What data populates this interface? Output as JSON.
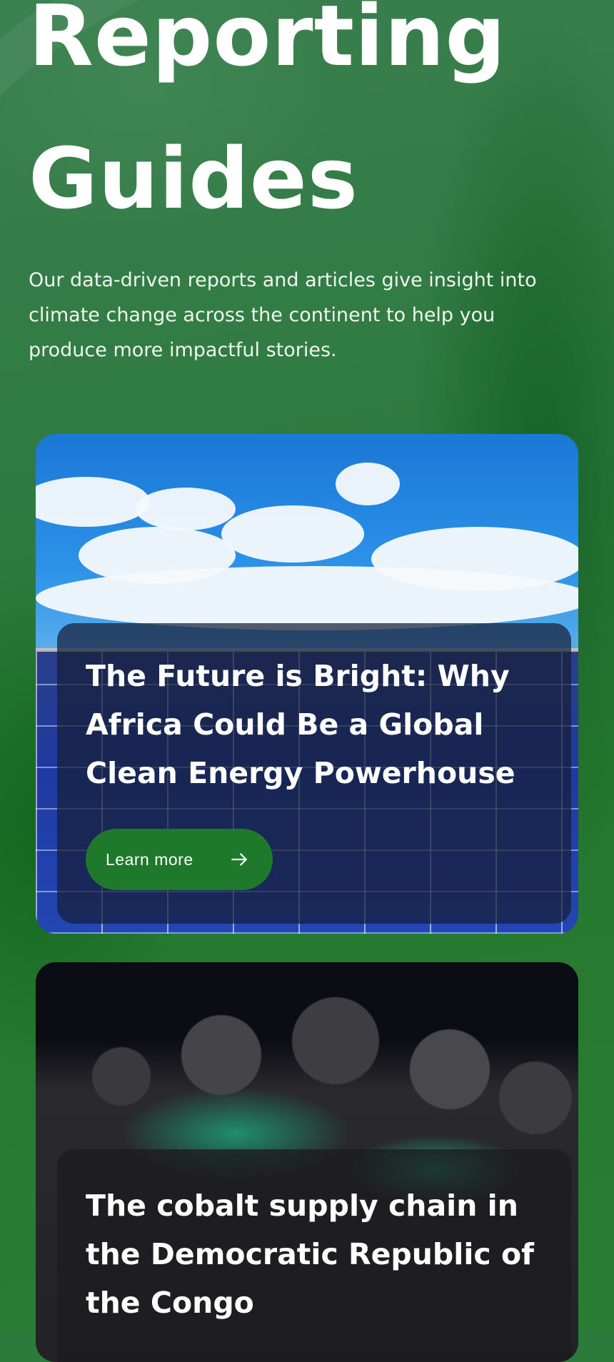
{
  "hero": {
    "title": "Reporting Guides",
    "description": "Our data-driven reports and articles give insight into climate change across the continent to help you produce more impactful stories."
  },
  "cards": [
    {
      "title": "The Future is Bright: Why Africa Could Be a Global Clean Energy Powerhouse",
      "button_label": "Learn more",
      "button_icon": "arrow-right-icon"
    },
    {
      "title": "The cobalt supply chain in the Democratic Republic of the Congo"
    }
  ],
  "colors": {
    "background_green": "#2c7a3c",
    "button_green": "#1e7a2a",
    "text": "#ffffff"
  }
}
